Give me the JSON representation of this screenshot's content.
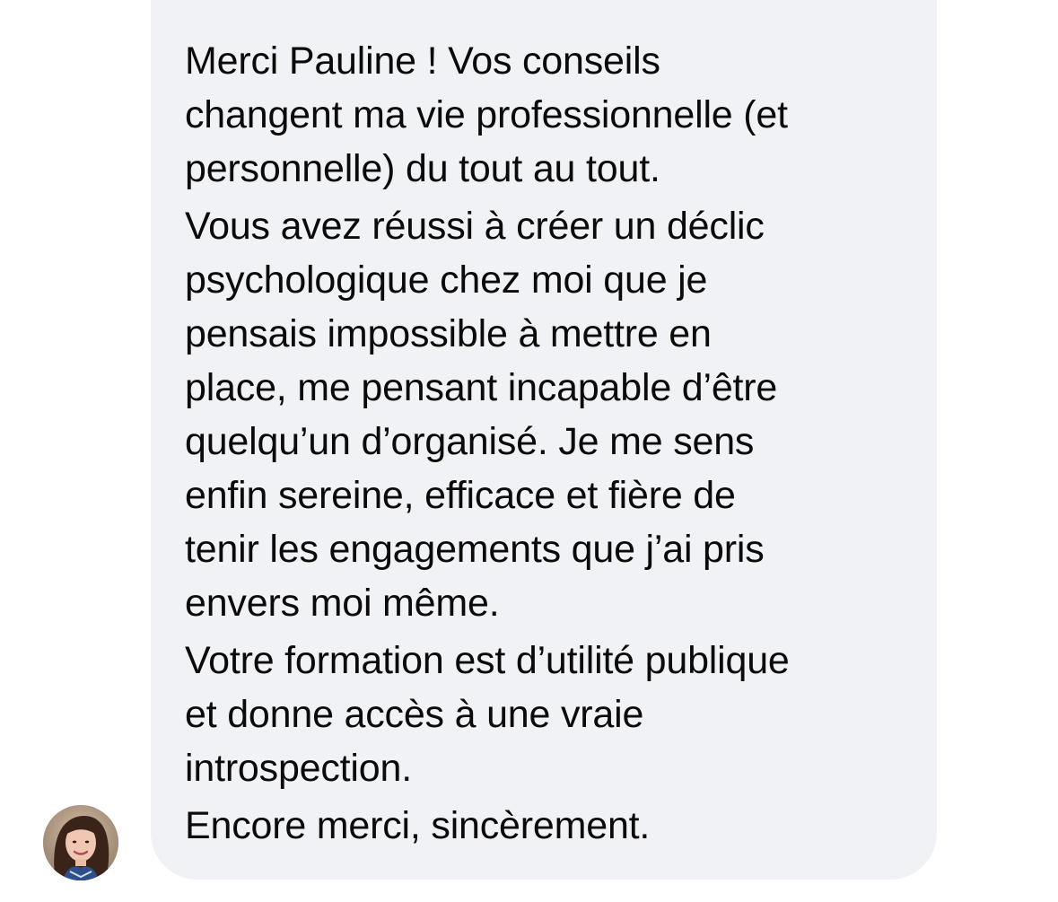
{
  "message": {
    "paragraphs": [
      "Merci Pauline ! Vos conseils\nchangent ma vie professionnelle (et\npersonnelle) du tout au tout.",
      "Vous avez réussi à créer un déclic\npsychologique chez moi que je\npensais impossible à mettre en\nplace, me pensant incapable d’être\nquelqu’un d’organisé. Je me sens\nenfin sereine, efficace et fière de\ntenir les engagements que j’ai pris\nenvers moi même.",
      "Votre formation est d’utilité publique\net donne accès à une vraie\nintrospection.",
      "Encore merci, sincèrement."
    ]
  },
  "avatar": {
    "icon": "sender-profile-photo"
  },
  "colors": {
    "bubble_background": "#f1f2f5",
    "text": "#0b0b0b",
    "page_background": "#ffffff"
  }
}
